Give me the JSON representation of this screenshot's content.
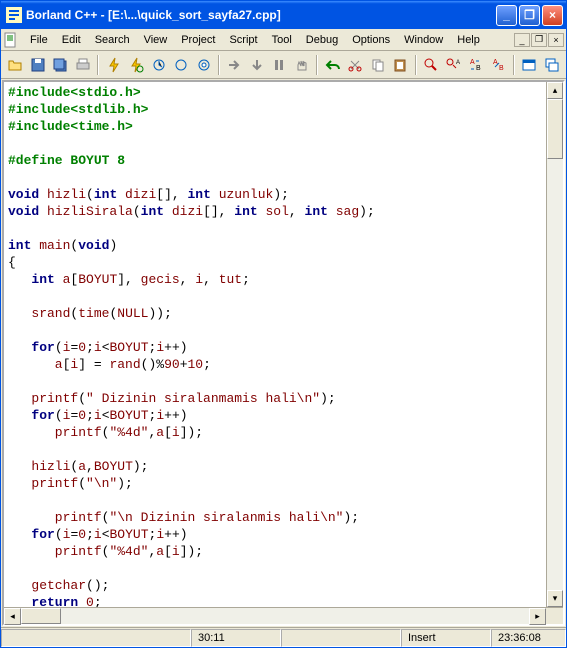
{
  "window": {
    "title": "Borland C++ - [E:\\...\\quick_sort_sayfa27.cpp]"
  },
  "menu": [
    "File",
    "Edit",
    "Search",
    "View",
    "Project",
    "Script",
    "Tool",
    "Debug",
    "Options",
    "Window",
    "Help"
  ],
  "mdi": {
    "min": "_",
    "restore": "❐",
    "close": "×"
  },
  "winbtns": {
    "min": "_",
    "max": "❐",
    "close": "×"
  },
  "status": {
    "pos": "30:11",
    "mode": "Insert",
    "time": "23:36:08"
  },
  "code": {
    "l1": "#include<stdio.h>",
    "l2": "#include<stdlib.h>",
    "l3": "#include<time.h>",
    "l4": "",
    "l5": "#define BOYUT 8",
    "l6": "",
    "l7a": "void",
    "l7b": " hizli",
    "l7c": "(",
    "l7d": "int",
    "l7e": " dizi",
    "l7f": "[], ",
    "l7g": "int",
    "l7h": " uzunluk",
    "l7i": ");",
    "l8a": "void",
    "l8b": " hizliSirala",
    "l8c": "(",
    "l8d": "int",
    "l8e": " dizi",
    "l8f": "[], ",
    "l8g": "int",
    "l8h": " sol",
    "l8i": ", ",
    "l8j": "int",
    "l8k": " sag",
    "l8l": ");",
    "l9": "",
    "l10a": "int",
    "l10b": " main",
    "l10c": "(",
    "l10d": "void",
    "l10e": ")",
    "l11": "{",
    "l12a": "   ",
    "l12b": "int",
    "l12c": " a",
    "l12d": "[",
    "l12e": "BOYUT",
    "l12f": "], ",
    "l12g": "gecis",
    "l12h": ", ",
    "l12i": "i",
    "l12j": ", ",
    "l12k": "tut",
    "l12l": ";",
    "l13": "",
    "l14a": "   srand",
    "l14b": "(",
    "l14c": "time",
    "l14d": "(",
    "l14e": "NULL",
    "l14f": "));",
    "l15": "",
    "l16a": "   ",
    "l16b": "for",
    "l16c": "(",
    "l16d": "i",
    "l16e": "=",
    "l16f": "0",
    "l16g": ";",
    "l16h": "i",
    "l16i": "<",
    "l16j": "BOYUT",
    "l16k": ";",
    "l16l": "i",
    "l16m": "++)",
    "l17a": "      a",
    "l17b": "[",
    "l17c": "i",
    "l17d": "] = ",
    "l17e": "rand",
    "l17f": "()%",
    "l17g": "90",
    "l17h": "+",
    "l17i": "10",
    "l17j": ";",
    "l18": "",
    "l19a": "   printf",
    "l19b": "(",
    "l19c": "\" Dizinin siralanmamis hali\\n\"",
    "l19d": ");",
    "l20a": "   ",
    "l20b": "for",
    "l20c": "(",
    "l20d": "i",
    "l20e": "=",
    "l20f": "0",
    "l20g": ";",
    "l20h": "i",
    "l20i": "<",
    "l20j": "BOYUT",
    "l20k": ";",
    "l20l": "i",
    "l20m": "++)",
    "l21a": "      printf",
    "l21b": "(",
    "l21c": "\"%4d\"",
    "l21d": ",",
    "l21e": "a",
    "l21f": "[",
    "l21g": "i",
    "l21h": "]);",
    "l22": "",
    "l23a": "   hizli",
    "l23b": "(",
    "l23c": "a",
    "l23d": ",",
    "l23e": "BOYUT",
    "l23f": ");",
    "l24a": "   printf",
    "l24b": "(",
    "l24c": "\"\\n\"",
    "l24d": ");",
    "l25": "",
    "l26a": "      printf",
    "l26b": "(",
    "l26c": "\"\\n Dizinin siralanmis hali\\n\"",
    "l26d": ");",
    "l27a": "   ",
    "l27b": "for",
    "l27c": "(",
    "l27d": "i",
    "l27e": "=",
    "l27f": "0",
    "l27g": ";",
    "l27h": "i",
    "l27i": "<",
    "l27j": "BOYUT",
    "l27k": ";",
    "l27l": "i",
    "l27m": "++)",
    "l28a": "      printf",
    "l28b": "(",
    "l28c": "\"%4d\"",
    "l28d": ",",
    "l28e": "a",
    "l28f": "[",
    "l28g": "i",
    "l28h": "]);",
    "l29": "",
    "l30a": "   getchar",
    "l30b": "();",
    "l31a": "   ",
    "l31b": "return",
    "l31c": " ",
    "l31d": "0",
    "l31e": ";",
    "l32": "",
    "l33": "}"
  }
}
